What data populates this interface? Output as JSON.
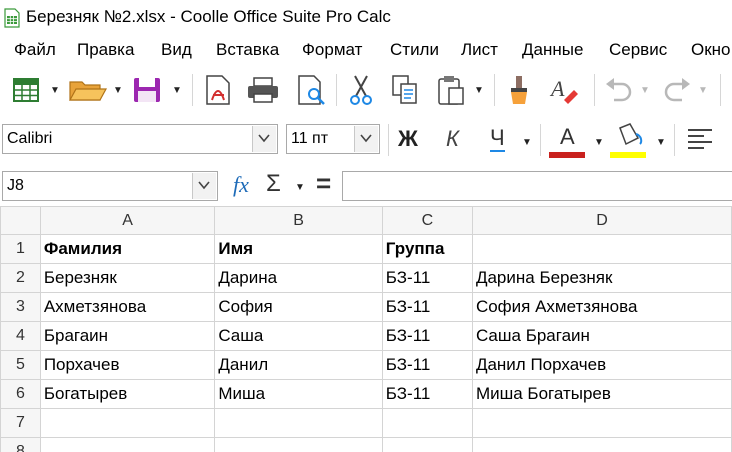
{
  "window": {
    "title": "Березняк №2.xlsx - Coolle Office Suite Pro Calc"
  },
  "menu": [
    "Файл",
    "Правка",
    "Вид",
    "Вставка",
    "Формат",
    "Стили",
    "Лист",
    "Данные",
    "Сервис",
    "Окно"
  ],
  "format_bar": {
    "font_name": "Calibri",
    "font_size": "11 пт",
    "bold_label": "Ж",
    "italic_label": "К",
    "underline_label": "Ч",
    "font_color_label": "А",
    "font_color": "#c9211e",
    "highlight_color": "#ffff00"
  },
  "formula_bar": {
    "name_box": "J8",
    "function_wizard_label": "fx",
    "sum_label": "Σ",
    "equals_label": "=",
    "input_value": ""
  },
  "sheet": {
    "columns": [
      "A",
      "B",
      "C",
      "D"
    ],
    "rows": [
      {
        "num": "1",
        "cells": [
          "Фамилия",
          "Имя",
          "Группа",
          ""
        ]
      },
      {
        "num": "2",
        "cells": [
          "Березняк",
          "Дарина",
          "БЗ-11",
          "Дарина Березняк"
        ]
      },
      {
        "num": "3",
        "cells": [
          "Ахметзянова",
          "София",
          "БЗ-11",
          "София Ахметзянова"
        ]
      },
      {
        "num": "4",
        "cells": [
          "Брагаин",
          "Саша",
          "БЗ-11",
          "Саша Брагаин"
        ]
      },
      {
        "num": "5",
        "cells": [
          "Порхачев",
          "Данил",
          "БЗ-11",
          "Данил Порхачев"
        ]
      },
      {
        "num": "6",
        "cells": [
          "Богатырев",
          "Миша",
          "БЗ-11",
          "Миша Богатырев"
        ]
      },
      {
        "num": "7",
        "cells": [
          "",
          "",
          "",
          ""
        ]
      },
      {
        "num": "8",
        "cells": [
          "",
          "",
          "",
          ""
        ]
      }
    ]
  }
}
